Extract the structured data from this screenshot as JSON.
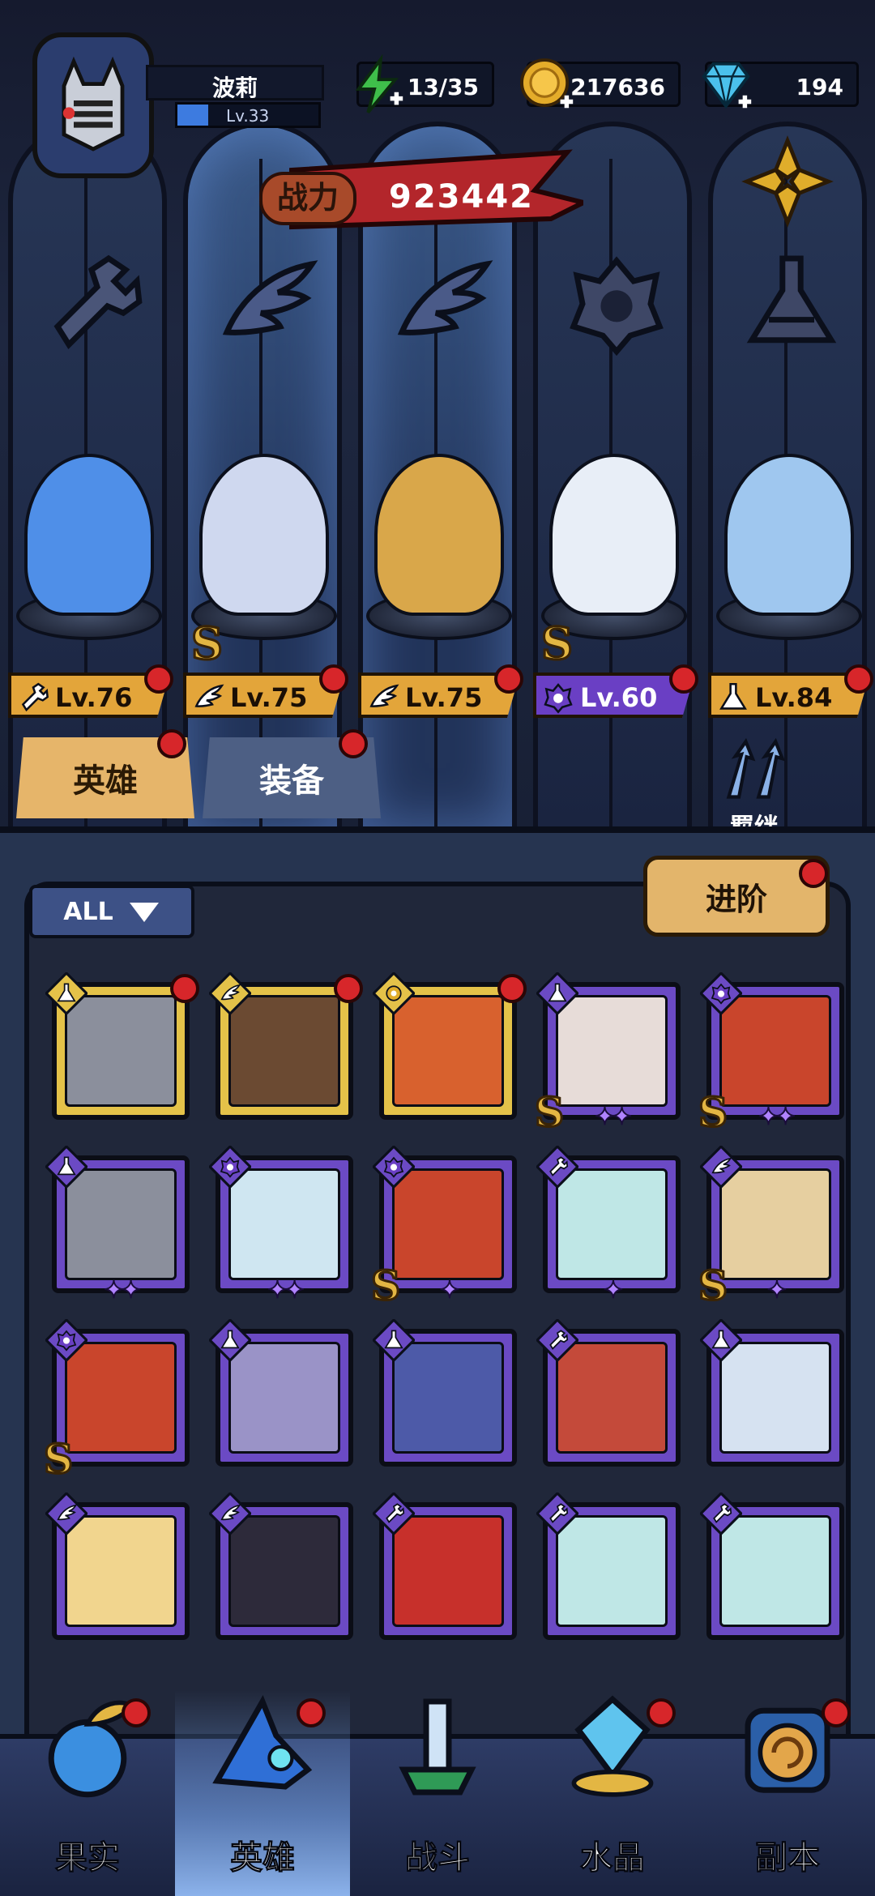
{
  "player": {
    "name": "波莉",
    "level": "Lv.33",
    "xp_progress": 0.22
  },
  "resources": {
    "energy": {
      "icon": "lightning-plus-icon",
      "value": "13/35"
    },
    "gold": {
      "icon": "gold-coin-plus-icon",
      "value": "217636"
    },
    "gems": {
      "icon": "diamond-plus-icon",
      "value": "194"
    }
  },
  "power": {
    "label": "战力",
    "value": "923442"
  },
  "team": [
    {
      "class": "wrench",
      "level": "Lv.76",
      "rank": "",
      "star_color": "gold",
      "hero_color": "#4f8fe8"
    },
    {
      "class": "wing",
      "level": "Lv.75",
      "rank": "S",
      "star_color": "gold",
      "hero_color": "#cfd8ef"
    },
    {
      "class": "wing",
      "level": "Lv.75",
      "rank": "",
      "star_color": "gold",
      "hero_color": "#d9a74a"
    },
    {
      "class": "demon",
      "level": "Lv.60",
      "rank": "S",
      "star_color": "purple",
      "hero_color": "#e8eef7"
    },
    {
      "class": "flask",
      "level": "Lv.84",
      "rank": "",
      "star_color": "gold",
      "hero_color": "#9fc7ef"
    }
  ],
  "tabs": {
    "heroes": "英雄",
    "gear": "装备"
  },
  "bond_label": "羁绊",
  "filter": {
    "label": "ALL"
  },
  "advance_label": "进阶",
  "roster": [
    {
      "frame": "gold",
      "class": "flask",
      "stars": "",
      "rank": "",
      "color": "#8b8f9c",
      "dot": true
    },
    {
      "frame": "gold",
      "class": "wing",
      "stars": "",
      "rank": "",
      "color": "#6b4a32",
      "dot": true
    },
    {
      "frame": "gold",
      "class": "gear-flower",
      "stars": "",
      "rank": "",
      "color": "#d8612e",
      "dot": true
    },
    {
      "frame": "purple",
      "class": "flask",
      "stars": "✦✦",
      "rank": "S",
      "color": "#e7dcd8",
      "dot": false
    },
    {
      "frame": "purple",
      "class": "demon",
      "stars": "✦✦",
      "rank": "S",
      "color": "#c9452c",
      "dot": false
    },
    {
      "frame": "purple",
      "class": "flask",
      "stars": "✦✦",
      "rank": "",
      "color": "#8b8f9c",
      "dot": false
    },
    {
      "frame": "purple",
      "class": "demon",
      "stars": "✦✦",
      "rank": "",
      "color": "#cfe6f1",
      "dot": false
    },
    {
      "frame": "purple",
      "class": "demon",
      "stars": "✦",
      "rank": "S",
      "color": "#c9452c",
      "dot": false
    },
    {
      "frame": "purple",
      "class": "wrench",
      "stars": "✦",
      "rank": "",
      "color": "#bfe7e6",
      "dot": false
    },
    {
      "frame": "purple",
      "class": "wing",
      "stars": "✦",
      "rank": "S",
      "color": "#e6cfa0",
      "dot": false
    },
    {
      "frame": "purple",
      "class": "demon",
      "stars": "",
      "rank": "S",
      "color": "#c9452c",
      "dot": false
    },
    {
      "frame": "purple",
      "class": "flask",
      "stars": "",
      "rank": "",
      "color": "#9a93c7",
      "dot": false
    },
    {
      "frame": "purple",
      "class": "flask",
      "stars": "",
      "rank": "",
      "color": "#4d5aa8",
      "dot": false
    },
    {
      "frame": "purple",
      "class": "wrench",
      "stars": "",
      "rank": "",
      "color": "#c44a3a",
      "dot": false
    },
    {
      "frame": "purple",
      "class": "flask",
      "stars": "",
      "rank": "",
      "color": "#d6e2f1",
      "dot": false
    },
    {
      "frame": "purple",
      "class": "wing",
      "stars": "",
      "rank": "",
      "color": "#f1d58e",
      "dot": false
    },
    {
      "frame": "purple",
      "class": "wing",
      "stars": "",
      "rank": "",
      "color": "#2d2a3a",
      "dot": false
    },
    {
      "frame": "purple",
      "class": "wrench",
      "stars": "",
      "rank": "",
      "color": "#c7302b",
      "dot": false
    },
    {
      "frame": "purple",
      "class": "wrench",
      "stars": "",
      "rank": "",
      "color": "#bfe7e6",
      "dot": false
    },
    {
      "frame": "purple",
      "class": "wrench",
      "stars": "",
      "rank": "",
      "color": "#bfe7e6",
      "dot": false
    }
  ],
  "nav": [
    {
      "label": "果实",
      "icon": "fruit-icon",
      "active": false,
      "dot": true
    },
    {
      "label": "英雄",
      "icon": "hero-hat-icon",
      "active": true,
      "dot": true
    },
    {
      "label": "战斗",
      "icon": "battle-icon",
      "active": false,
      "dot": false
    },
    {
      "label": "水晶",
      "icon": "crystal-icon",
      "active": false,
      "dot": true
    },
    {
      "label": "副本",
      "icon": "dungeon-portal-icon",
      "active": false,
      "dot": true
    }
  ],
  "colors": {
    "gold_frame": "#e4c249",
    "purple_frame": "#6b4ac4",
    "accent_red": "#d7262a",
    "tab_active": "#e6b56a"
  }
}
